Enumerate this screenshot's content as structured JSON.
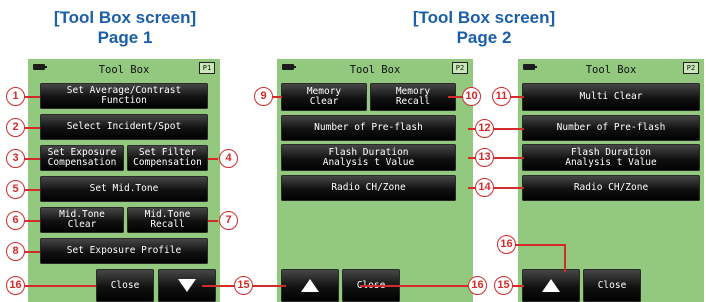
{
  "headings": {
    "left": "[Tool Box screen]",
    "left_page": "Page 1",
    "right": "[Tool Box screen]",
    "right_page": "Page 2"
  },
  "screens": {
    "page1": {
      "title": "Tool Box",
      "page_icon": "P1",
      "buttons": {
        "average_contrast_1": "Set Average/Contrast",
        "average_contrast_2": "Function",
        "incident_spot": "Select Incident/Spot",
        "exposure_comp_1": "Set Exposure",
        "exposure_comp_2": "Compensation",
        "filter_comp_1": "Set Filter",
        "filter_comp_2": "Compensation",
        "mid_tone": "Set Mid.Tone",
        "mid_tone_clear_1": "Mid.Tone",
        "mid_tone_clear_2": "Clear",
        "mid_tone_recall_1": "Mid.Tone",
        "mid_tone_recall_2": "Recall",
        "exposure_profile": "Set Exposure Profile",
        "close": "Close"
      }
    },
    "page2a": {
      "title": "Tool Box",
      "page_icon": "P2",
      "buttons": {
        "memory_clear_1": "Memory",
        "memory_clear_2": "Clear",
        "memory_recall_1": "Memory",
        "memory_recall_2": "Recall",
        "pre_flash": "Number of Pre-flash",
        "flash_duration_1": "Flash Duration",
        "flash_duration_2": "Analysis t Value",
        "radio": "Radio CH/Zone",
        "close": "Close"
      }
    },
    "page2b": {
      "title": "Tool Box",
      "page_icon": "P2",
      "buttons": {
        "multi_clear": "Multi Clear",
        "pre_flash": "Number of Pre-flash",
        "flash_duration_1": "Flash Duration",
        "flash_duration_2": "Analysis t Value",
        "radio": "Radio CH/Zone",
        "close": "Close"
      }
    }
  },
  "callouts": [
    "1",
    "2",
    "3",
    "4",
    "5",
    "6",
    "7",
    "8",
    "9",
    "10",
    "11",
    "12",
    "13",
    "14",
    "15",
    "16"
  ],
  "icons": [
    "battery-icon",
    "page-icon",
    "up-arrow-icon",
    "down-arrow-icon"
  ],
  "colors": {
    "heading": "#1b5fa8",
    "screen_bg": "#93c97f",
    "callout": "#d32a2a",
    "button": "#111111"
  }
}
